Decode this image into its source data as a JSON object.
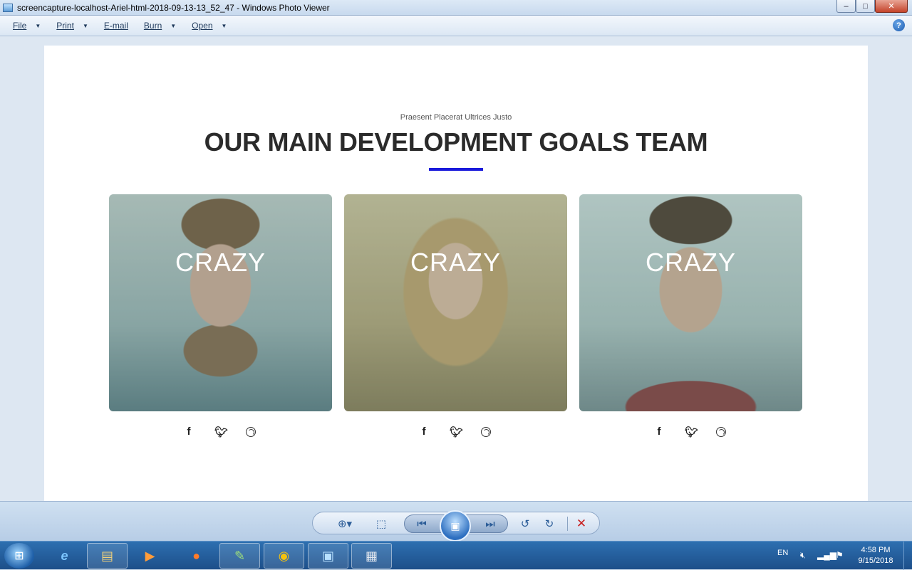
{
  "window": {
    "title": "screencapture-localhost-Ariel-html-2018-09-13-13_52_47 - Windows Photo Viewer",
    "minimize": "–",
    "maximize": "□",
    "close": "✕"
  },
  "menu": {
    "items": [
      {
        "label": "File",
        "has_arrow": true
      },
      {
        "label": "Print",
        "has_arrow": true
      },
      {
        "label": "E-mail",
        "has_arrow": false
      },
      {
        "label": "Burn",
        "has_arrow": true
      },
      {
        "label": "Open",
        "has_arrow": true
      }
    ],
    "help": "?"
  },
  "page": {
    "subtitle": "Praesent Placerat Ultrices Justo",
    "heading": "OUR MAIN DEVELOPMENT GOALS TEAM",
    "accent_color": "#1a1adb",
    "cards": [
      {
        "caption": "CRAZY"
      },
      {
        "caption": "CRAZY"
      },
      {
        "caption": "CRAZY"
      }
    ],
    "social_icons": [
      "facebook-icon",
      "twitter-icon",
      "dribbble-icon"
    ]
  },
  "controls": {
    "zoom": "⊕▾",
    "fit": "⬚",
    "previous": "⏮",
    "slideshow": "▣",
    "next": "⏭",
    "rotate_left": "↺",
    "rotate_right": "↻",
    "delete": "✕"
  },
  "taskbar": {
    "language": "EN",
    "time": "4:58 PM",
    "date": "9/15/2018"
  }
}
